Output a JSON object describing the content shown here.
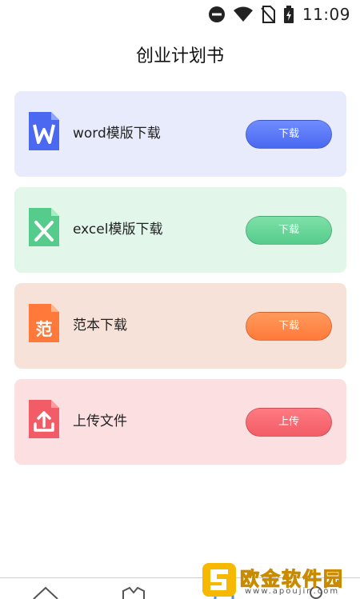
{
  "status_bar": {
    "time": "11:09"
  },
  "page_title": "创业计划书",
  "cards": [
    {
      "label": "word模版下载",
      "button": "下载",
      "icon_text": "W",
      "color": "#4a68f0",
      "bg": "#e7ebfb"
    },
    {
      "label": "excel模版下载",
      "button": "下载",
      "icon_text": "X",
      "color": "#56cc8c",
      "bg": "#e2f6e9"
    },
    {
      "label": "范本下载",
      "button": "下载",
      "icon_text": "范",
      "color": "#ff7a3a",
      "bg": "#f6e2d8"
    },
    {
      "label": "上传文件",
      "button": "上传",
      "icon_text": "",
      "color": "#f25c66",
      "bg": "#fbdfe1"
    }
  ],
  "watermark": {
    "text": "欧金软件园",
    "url": "www.apoujin.com",
    "color": "#f6b800"
  }
}
